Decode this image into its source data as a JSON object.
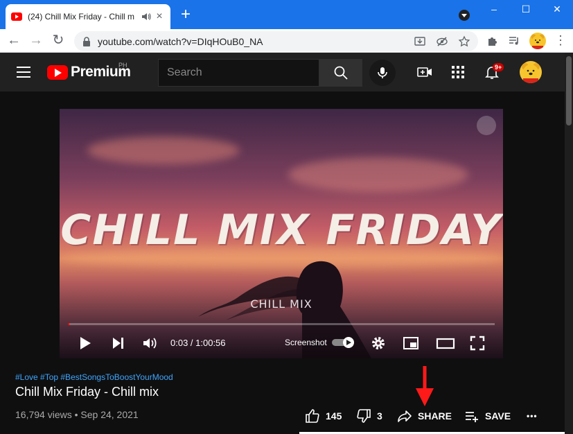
{
  "browser": {
    "tab_title": "(24) Chill Mix Friday - Chill m",
    "tab_close": "×",
    "new_tab": "+",
    "window_controls": [
      "–",
      "☐",
      "✕"
    ],
    "url": "youtube.com/watch?v=DIqHOuB0_NA",
    "nav": {
      "back": "←",
      "forward": "→",
      "reload": "↻"
    },
    "menu": "⋮"
  },
  "youtube": {
    "logo_text": "Premium",
    "country": "PH",
    "search_placeholder": "Search",
    "notification_badge": "9+"
  },
  "player": {
    "overlay_title": "CHILL MIX FRIDAY",
    "overlay_subtitle": "CHILL MIX",
    "time": "0:03 / 1:00:56",
    "screenshot_label": "Screenshot",
    "progress": 0.001
  },
  "video": {
    "hashtags": "#Love #Top #BestSongsToBoostYourMood",
    "title": "Chill Mix Friday - Chill mix",
    "views_date": "16,794 views • Sep 24, 2021",
    "likes": "145",
    "dislikes": "3",
    "share_label": "SHARE",
    "save_label": "SAVE",
    "more": "•••"
  },
  "colors": {
    "chrome_blue": "#1a73e8",
    "yt_red": "#ff0000",
    "link_blue": "#3ea6ff",
    "annotation_red": "#ff1a1a"
  }
}
